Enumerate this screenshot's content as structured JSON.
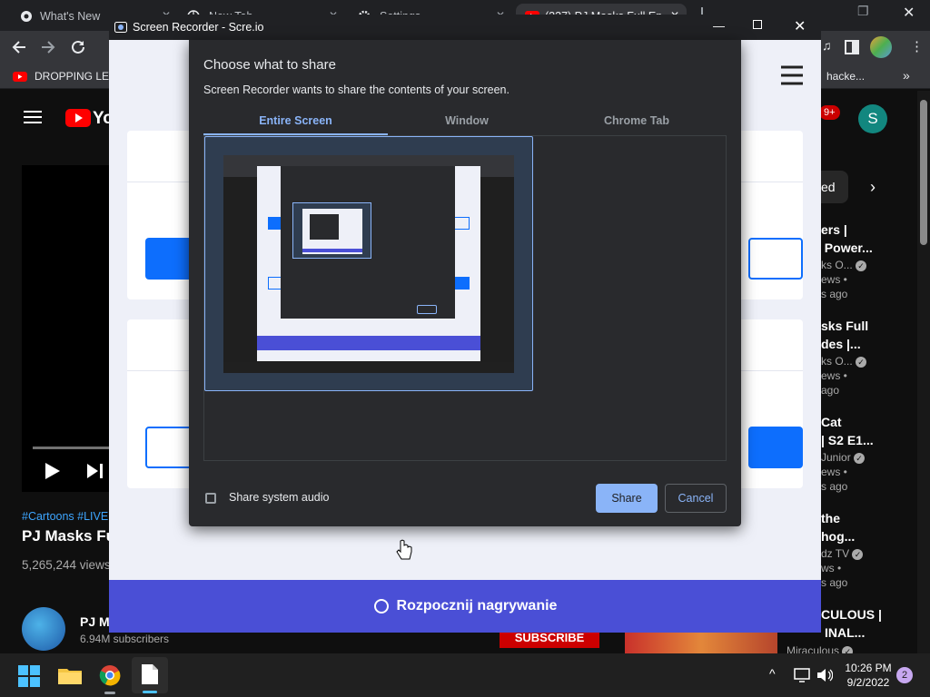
{
  "chrome": {
    "tabs": [
      {
        "label": "What's New"
      },
      {
        "label": "New Tab"
      },
      {
        "label": "Settings"
      },
      {
        "label": "(237) PJ Masks Full Epis"
      }
    ],
    "bookmark_left": "DROPPING LEG",
    "bookmark_right": "hacke..."
  },
  "youtube": {
    "logo": "Yo",
    "notif_count": "9+",
    "avatar_letter": "S",
    "hashtags": "#Cartoons #LIVE",
    "video_title": "PJ Masks Fu",
    "views": "5,265,244 views",
    "channel": "PJ M",
    "subscribers": "6.94M subscribers",
    "subscribe": "SUBSCRIBE",
    "chip": "ed",
    "side_items": [
      {
        "line1": "ers |",
        "line2": "| Power...",
        "channel": "ks O...",
        "stats": "ews •",
        "age": "s ago",
        "verified": true
      },
      {
        "line1": "sks Full",
        "line2": "des |...",
        "channel": "ks O...",
        "stats": "ews •",
        "age": "ago",
        "verified": true
      },
      {
        "line1": "Cat",
        "line2": "| S2 E1...",
        "channel": "Junior",
        "stats": "ews •",
        "age": "s ago",
        "verified": true
      },
      {
        "line1": "the",
        "line2": "hog...",
        "channel": "dz TV",
        "stats": "ws •",
        "age": "s ago",
        "verified": true
      },
      {
        "line1": "CULOUS |",
        "line2": "INAL...",
        "channel": "Miraculous",
        "stats": "",
        "age": "",
        "verified": true
      }
    ]
  },
  "recorder": {
    "window_title": "Screen Recorder - Scre.io",
    "start_label": "Rozpocznij nagrywanie"
  },
  "dialog": {
    "title": "Choose what to share",
    "subtitle": "Screen Recorder wants to share the contents of your screen.",
    "tabs": [
      "Entire Screen",
      "Window",
      "Chrome Tab"
    ],
    "audio_label": "Share system audio",
    "share": "Share",
    "cancel": "Cancel"
  },
  "taskbar": {
    "time": "10:26 PM",
    "date": "9/2/2022",
    "badge": "2"
  },
  "colors": {
    "accent": "#8ab4f8",
    "recorder_bar": "#4a4fd6",
    "primary_blue": "#0d6efd"
  }
}
